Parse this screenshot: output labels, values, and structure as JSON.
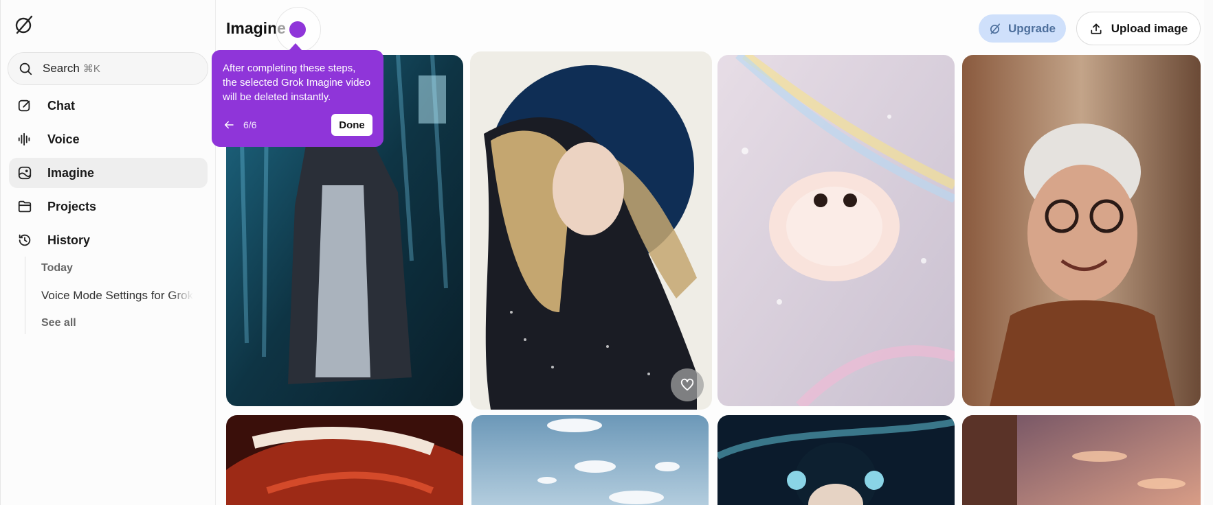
{
  "app": {
    "logo_icon": "grok-logo-icon"
  },
  "search": {
    "label": "Search",
    "shortcut": "⌘K"
  },
  "sidebar": {
    "items": [
      {
        "label": "Chat",
        "icon": "edit-icon"
      },
      {
        "label": "Voice",
        "icon": "waveform-icon"
      },
      {
        "label": "Imagine",
        "icon": "imagine-icon",
        "active": true
      },
      {
        "label": "Projects",
        "icon": "folder-icon"
      },
      {
        "label": "History",
        "icon": "history-icon"
      }
    ],
    "history": {
      "group_label": "Today",
      "entries": [
        "Voice Mode Settings for Grok"
      ],
      "see_all": "See all"
    }
  },
  "header": {
    "title": "Imagine",
    "upgrade_label": "Upgrade",
    "upload_label": "Upload image"
  },
  "tooltip": {
    "text": "After completing these steps, the selected Grok Imagine video will be deleted instantly.",
    "step": "6/6",
    "done_label": "Done"
  },
  "gallery": {
    "tiles": [
      {
        "subject": "man in leather trench coat, blue light",
        "palette": [
          "#0f3a4a",
          "#2d8fb0"
        ]
      },
      {
        "subject": "woman with flowing golden hair, dark blue circle",
        "palette": [
          "#f1efe9",
          "#12305a"
        ]
      },
      {
        "subject": "fluffy creature with rainbow light",
        "palette": [
          "#d9cfe0",
          "#f4c8b8"
        ]
      },
      {
        "subject": "smiling elderly woman with glasses",
        "palette": [
          "#7a4b32",
          "#c9b29c"
        ]
      },
      {
        "subject": "red helmet close-up",
        "palette": [
          "#3a0f0a",
          "#d44a2a"
        ]
      },
      {
        "subject": "sky with clouds",
        "palette": [
          "#7fa7c4",
          "#cfe2ee"
        ]
      },
      {
        "subject": "anime character with headphones",
        "palette": [
          "#0b1b2c",
          "#5ab6c9"
        ]
      },
      {
        "subject": "sunset over building",
        "palette": [
          "#4c2b35",
          "#d98b7a"
        ]
      }
    ],
    "heart_icon": "heart-icon"
  },
  "colors": {
    "accent": "#8f35d9",
    "upgrade_bg": "#cfe0fb"
  }
}
